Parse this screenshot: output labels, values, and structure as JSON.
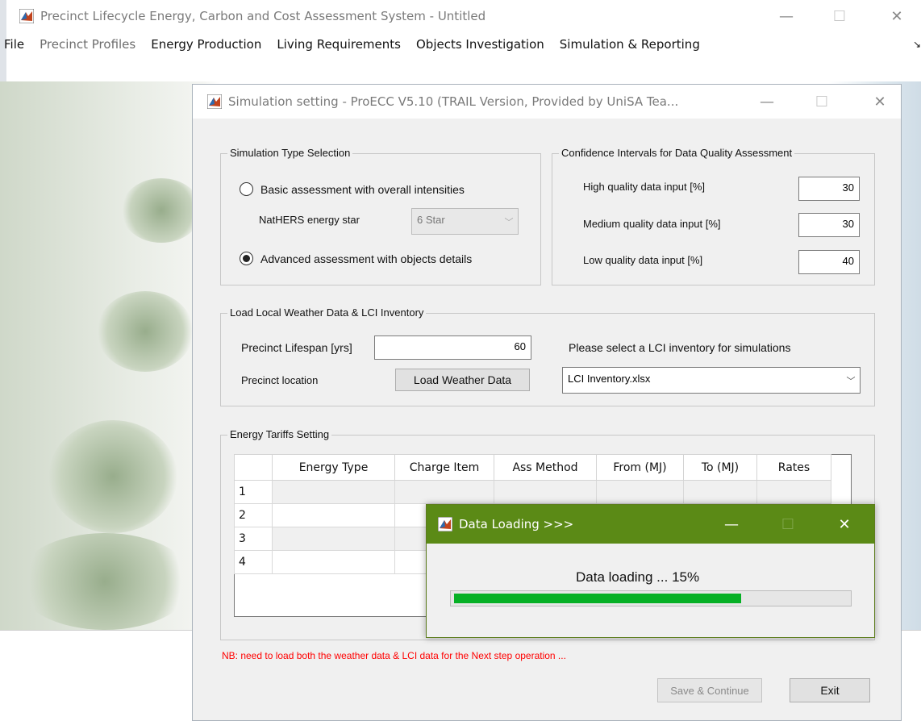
{
  "main_window": {
    "title": "Precinct Lifecycle Energy, Carbon and Cost Assessment System  -  Untitled",
    "controls": {
      "minimize": "—",
      "maximize": "☐",
      "close": "✕"
    },
    "menu": [
      "File",
      "Precinct Profiles",
      "Energy Production",
      "Living Requirements",
      "Objects Investigation",
      "Simulation & Reporting"
    ],
    "menu_overflow": "↘"
  },
  "dialog": {
    "title": "Simulation setting  -  ProECC V5.10 (TRAIL Version, Provided by UniSA Tea...",
    "controls": {
      "minimize": "—",
      "maximize": "☐",
      "close": "✕"
    },
    "sim_type": {
      "legend": "Simulation Type Selection",
      "basic_label": "Basic assessment with overall intensities",
      "nathers_label": "NatHERS energy star",
      "nathers_value": "6 Star",
      "advanced_label": "Advanced assessment with objects details",
      "selected": "advanced"
    },
    "confidence": {
      "legend": "Confidence Intervals for Data Quality Assessment",
      "high_label": "High quality data input [%]",
      "high_value": "30",
      "medium_label": "Medium quality data input [%]",
      "medium_value": "30",
      "low_label": "Low quality data input [%]",
      "low_value": "40"
    },
    "weather": {
      "legend": "Load Local Weather Data & LCI Inventory",
      "lifespan_label": "Precinct Lifespan [yrs]",
      "lifespan_value": "60",
      "location_label": "Precinct location",
      "load_button": "Load Weather Data",
      "lci_prompt": "Please select a LCI inventory for simulations",
      "lci_value": "LCI Inventory.xlsx"
    },
    "tariffs": {
      "legend": "Energy Tariffs Setting",
      "columns": [
        "Energy Type",
        "Charge Item",
        "Ass Method",
        "From (MJ)",
        "To (MJ)",
        "Rates"
      ],
      "rows": [
        "1",
        "2",
        "3",
        "4"
      ]
    },
    "note": "NB: need to load both the weather data & LCI data for the Next step operation ...",
    "save_button": "Save & Continue",
    "exit_button": "Exit"
  },
  "loading_dialog": {
    "title": "Data Loading >>>",
    "controls": {
      "minimize": "—",
      "maximize": "☐",
      "close": "✕"
    },
    "message": "Data loading ... 15%",
    "progress_fraction": 0.73
  },
  "colors": {
    "loader_title_bg": "#5b8a16",
    "progress_fill": "#06b025",
    "note_text": "#ff0000"
  }
}
